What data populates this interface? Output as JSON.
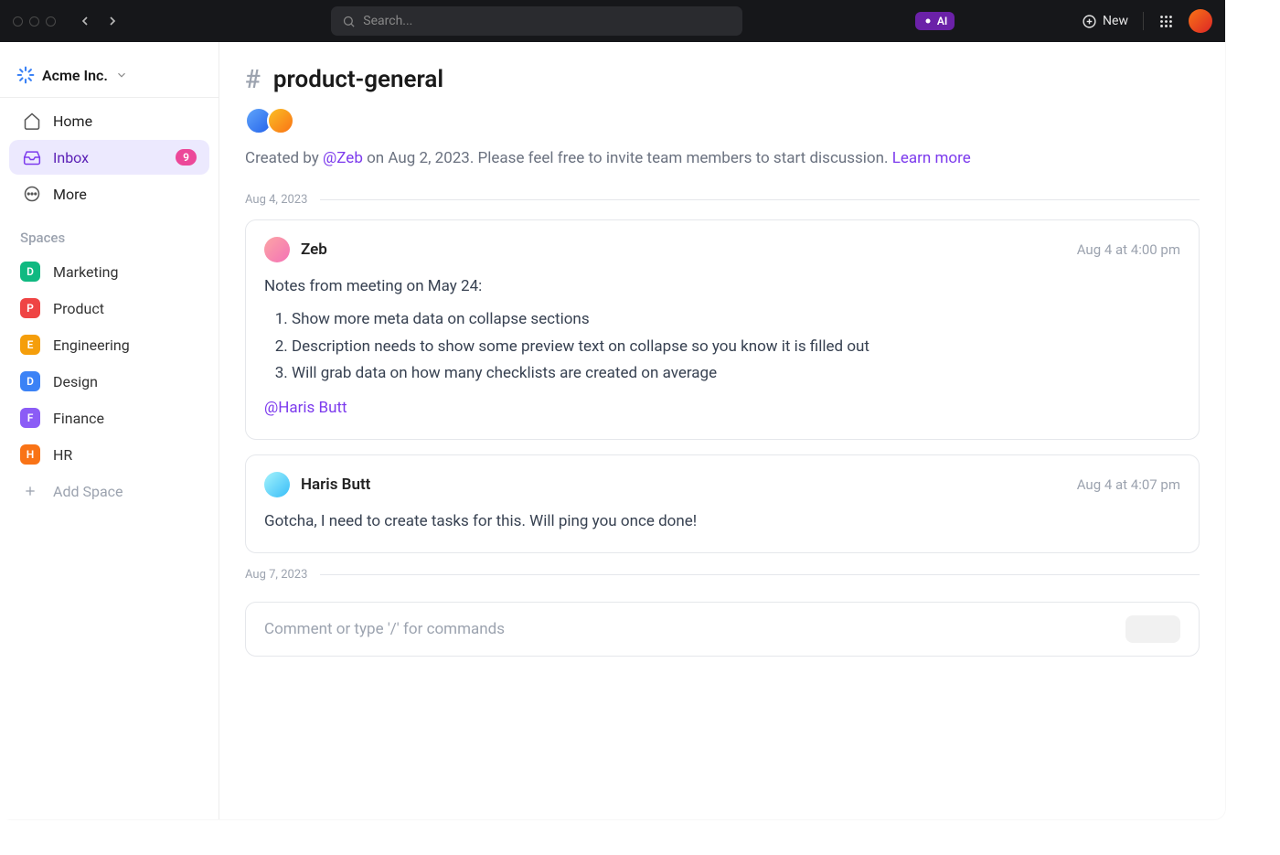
{
  "titlebar": {
    "search_placeholder": "Search...",
    "ai_label": "AI",
    "new_label": "New"
  },
  "workspace": {
    "name": "Acme Inc."
  },
  "nav": {
    "home": "Home",
    "inbox": "Inbox",
    "inbox_count": "9",
    "more": "More"
  },
  "spaces_title": "Spaces",
  "spaces": [
    {
      "letter": "D",
      "label": "Marketing",
      "color": "#10b981"
    },
    {
      "letter": "P",
      "label": "Product",
      "color": "#ef4444"
    },
    {
      "letter": "E",
      "label": "Engineering",
      "color": "#f59e0b"
    },
    {
      "letter": "D",
      "label": "Design",
      "color": "#3b82f6"
    },
    {
      "letter": "F",
      "label": "Finance",
      "color": "#8b5cf6"
    },
    {
      "letter": "H",
      "label": "HR",
      "color": "#f97316"
    }
  ],
  "add_space": "Add Space",
  "channel": {
    "name": "product-general",
    "created_prefix": "Created by ",
    "created_author": "@Zeb",
    "created_suffix": " on Aug 2, 2023. Please feel free to invite team members to start discussion. ",
    "learn_more": "Learn more"
  },
  "dates": {
    "d1": "Aug 4, 2023",
    "d2": "Aug 7, 2023"
  },
  "msg1": {
    "author": "Zeb",
    "time": "Aug 4 at 4:00 pm",
    "intro": "Notes from meeting on May 24:",
    "items": [
      "Show more meta data on collapse sections",
      "Description needs to show some preview text on collapse so you know it is filled out",
      "Will grab data on how many checklists are created on average"
    ],
    "mention": "@Haris Butt"
  },
  "msg2": {
    "author": "Haris Butt",
    "time": "Aug 4 at 4:07 pm",
    "body": "Gotcha, I need to create tasks for this. Will ping you once done!"
  },
  "composer": {
    "placeholder": "Comment or type '/' for commands"
  }
}
